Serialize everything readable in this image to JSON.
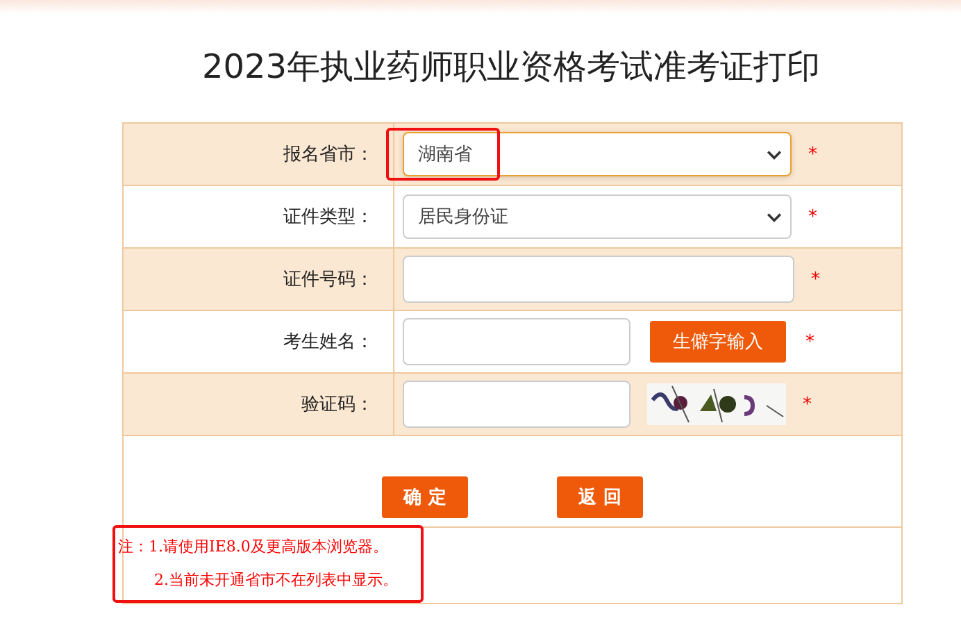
{
  "title": "2023年执业药师职业资格考试准考证打印",
  "rows": [
    {
      "kind": "select",
      "label": "报名省市：",
      "value": "湖南省",
      "highlighted": true,
      "required": "*"
    },
    {
      "kind": "select",
      "label": "证件类型：",
      "value": "居民身份证",
      "highlighted": false,
      "required": "*"
    },
    {
      "kind": "input",
      "label": "证件号码：",
      "required": "*"
    },
    {
      "kind": "input_button",
      "label": "考生姓名：",
      "button": "生僻字输入",
      "required": "*"
    },
    {
      "kind": "captcha",
      "label": "验证码：",
      "required": "*"
    }
  ],
  "buttons": [
    "确 定",
    "返 回"
  ],
  "notes": {
    "highlighted": true,
    "lines": [
      "注：1.请使用IE8.0及更高版本浏览器。",
      "2.当前未开通省市不在列表中显示。"
    ]
  }
}
